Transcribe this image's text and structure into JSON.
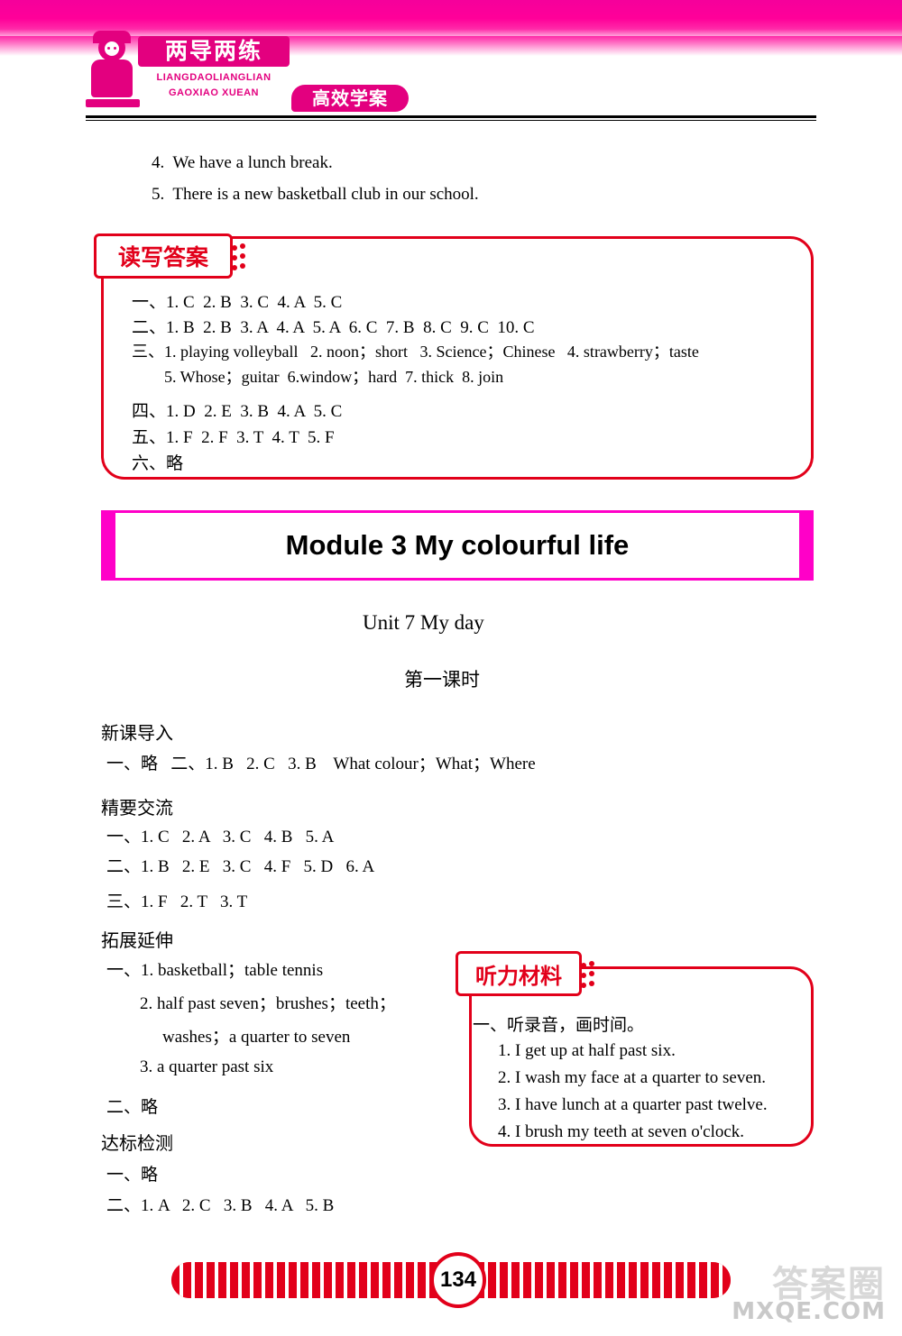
{
  "logo": {
    "title": "两导两练",
    "pinyin_line1": "LIANGDAOLIANGLIAN",
    "pinyin_line2": "GAOXIAO XUEAN",
    "subtitle": "高效学案"
  },
  "top_sentences": [
    "4.  We have a lunch break.",
    "5.  There is a new basketball club in our school."
  ],
  "answer_box": {
    "tag": "读写答案",
    "lines": [
      "一、1. C  2. B  3. C  4. A  5. C",
      "二、1. B  2. B  3. A  4. A  5. A  6. C  7. B  8. C  9. C  10. C",
      "三、1. playing volleyball   2. noon；short   3. Science；Chinese   4. strawberry；taste",
      "5. Whose；guitar  6.window；hard  7. thick  8. join",
      "四、1. D  2. E  3. B  4. A  5. C",
      "五、1. F  2. F  3. T  4. T  5. F",
      "六、略"
    ]
  },
  "module": {
    "title": "Module 3 My colourful life",
    "unit": "Unit 7 My day",
    "period": "第一课时"
  },
  "sections": [
    {
      "heading": "新课导入",
      "lines": [
        "一、略   二、1. B   2. C   3. B    What colour；What；Where"
      ]
    },
    {
      "heading": "精要交流",
      "lines": [
        "一、1. C   2. A   3. C   4. B   5. A",
        "二、1. B   2. E   3. C   4. F   5. D   6. A",
        "三、1. F   2. T   3. T"
      ]
    },
    {
      "heading": "拓展延伸",
      "lines": [
        "一、1. basketball；table tennis",
        "2. half past seven；brushes；teeth；",
        "washes；a quarter to seven",
        "3. a quarter past six",
        "二、略"
      ]
    },
    {
      "heading": "达标检测",
      "lines": [
        "一、略",
        "二、1. A   2. C   3. B   4. A   5. B"
      ]
    }
  ],
  "listening_box": {
    "tag": "听力材料",
    "lines": [
      "一、听录音，画时间。",
      "1. I get up at half past six.",
      "2. I wash my face at a quarter to seven.",
      "3. I have lunch at a quarter past twelve.",
      "4. I brush my teeth at seven o'clock."
    ]
  },
  "footer": {
    "page_number": "134",
    "watermark_top": "答案圈",
    "watermark_bottom": "MXQE.COM"
  },
  "colors": {
    "magenta": "#ff0099",
    "red": "#e2001a",
    "pink": "#ff00c8"
  }
}
